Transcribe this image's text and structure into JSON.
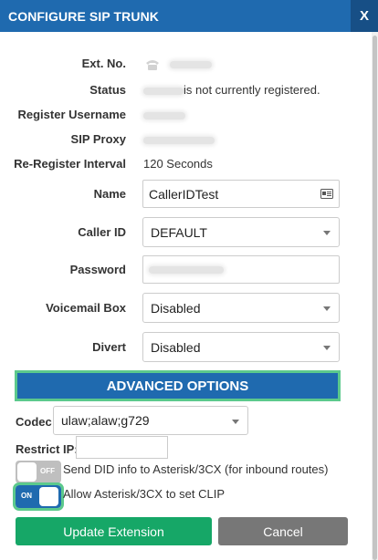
{
  "window": {
    "title": "CONFIGURE SIP TRUNK",
    "close_label": "X"
  },
  "fields": {
    "ext_no": {
      "label": "Ext. No.",
      "icon": "phone-icon"
    },
    "status": {
      "label": "Status",
      "suffix": "is not currently registered."
    },
    "register_username": {
      "label": "Register Username"
    },
    "sip_proxy": {
      "label": "SIP Proxy"
    },
    "reregister_interval": {
      "label": "Re-Register Interval",
      "value": "120 Seconds"
    },
    "name": {
      "label": "Name",
      "value": "CallerIDTest",
      "icon": "contact-card-icon"
    },
    "caller_id": {
      "label": "Caller ID",
      "value": "DEFAULT"
    },
    "password": {
      "label": "Password"
    },
    "voicemail_box": {
      "label": "Voicemail Box",
      "value": "Disabled"
    },
    "divert": {
      "label": "Divert",
      "value": "Disabled"
    }
  },
  "advanced": {
    "header": "ADVANCED OPTIONS",
    "codec": {
      "label": "Codec:",
      "value": "ulaw;alaw;g729"
    },
    "restrict_ip": {
      "label": "Restrict IP:",
      "value": ""
    },
    "send_did": {
      "state": "OFF",
      "label": "Send DID info to Asterisk/3CX (for inbound routes)"
    },
    "allow_clip": {
      "state": "ON",
      "label": "Allow Asterisk/3CX to set CLIP"
    }
  },
  "buttons": {
    "update": "Update Extension",
    "cancel": "Cancel"
  },
  "colors": {
    "primary": "#1f6aaf",
    "success": "#16a767",
    "neutral": "#777777",
    "highlight": "#5cc98c"
  }
}
